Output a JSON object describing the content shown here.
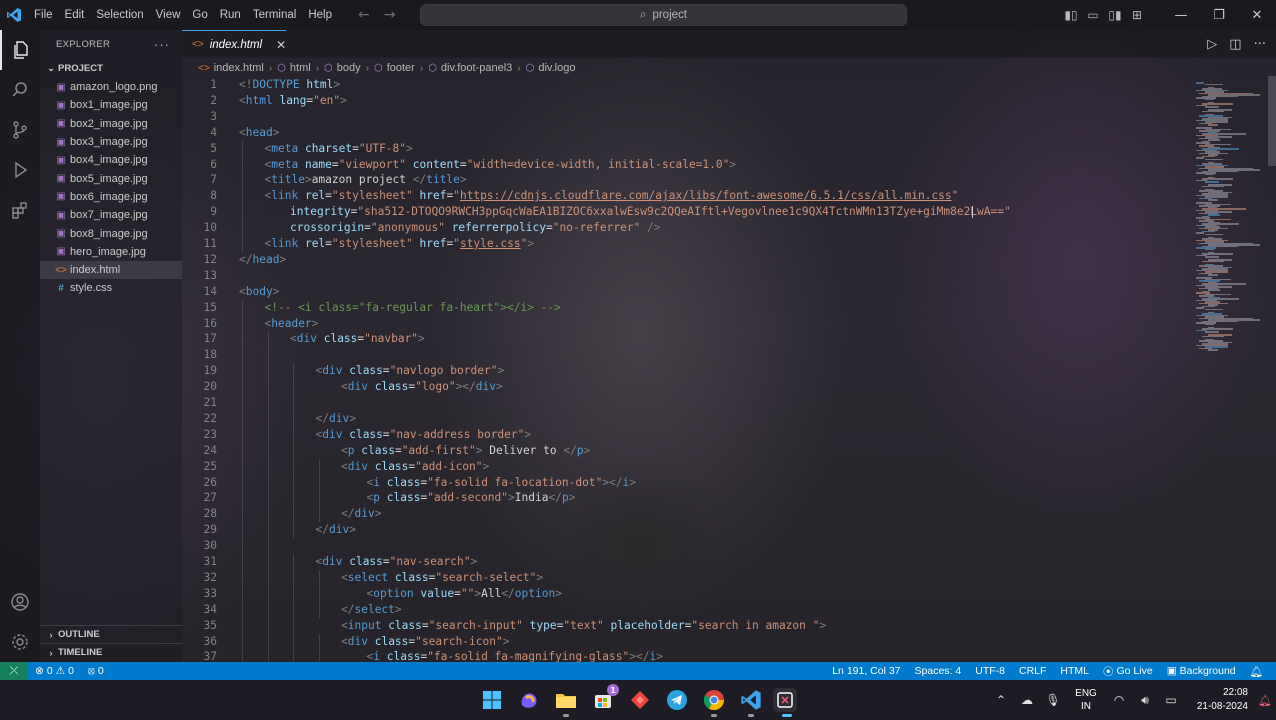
{
  "menu": [
    "File",
    "Edit",
    "Selection",
    "View",
    "Go",
    "Run",
    "Terminal",
    "Help"
  ],
  "search": {
    "label": "project"
  },
  "sidebar": {
    "title": "EXPLORER",
    "project": "PROJECT",
    "files": [
      {
        "name": "amazon_logo.png",
        "type": "image"
      },
      {
        "name": "box1_image.jpg",
        "type": "image"
      },
      {
        "name": "box2_image.jpg",
        "type": "image"
      },
      {
        "name": "box3_image.jpg",
        "type": "image"
      },
      {
        "name": "box4_image.jpg",
        "type": "image"
      },
      {
        "name": "box5_image.jpg",
        "type": "image"
      },
      {
        "name": "box6_image.jpg",
        "type": "image"
      },
      {
        "name": "box7_image.jpg",
        "type": "image"
      },
      {
        "name": "box8_image.jpg",
        "type": "image"
      },
      {
        "name": "hero_image.jpg",
        "type": "image"
      },
      {
        "name": "index.html",
        "type": "html",
        "selected": true
      },
      {
        "name": "style.css",
        "type": "css"
      }
    ],
    "outline": "OUTLINE",
    "timeline": "TIMELINE"
  },
  "tab": {
    "label": "index.html"
  },
  "breadcrumb": [
    "index.html",
    "html",
    "body",
    "footer",
    "div.foot-panel3",
    "div.logo"
  ],
  "code": [
    {
      "n": "1",
      "indent": 0,
      "html": "<span class=\"t\">&lt;!</span><span class=\"tag\">DOCTYPE</span> <span class=\"at\">html</span><span class=\"t\">&gt;</span>"
    },
    {
      "n": "2",
      "indent": 0,
      "html": "<span class=\"t\">&lt;</span><span class=\"tag\">html</span> <span class=\"at\">lang</span><span class=\"txt\">=</span><span class=\"str\">\"en\"</span><span class=\"t\">&gt;</span>"
    },
    {
      "n": "3",
      "indent": 0,
      "html": ""
    },
    {
      "n": "4",
      "indent": 0,
      "html": "<span class=\"t\">&lt;</span><span class=\"tag\">head</span><span class=\"t\">&gt;</span>"
    },
    {
      "n": "5",
      "indent": 1,
      "html": "<span class=\"t\">&lt;</span><span class=\"tag\">meta</span> <span class=\"at\">charset</span><span class=\"txt\">=</span><span class=\"str\">\"UTF-8\"</span><span class=\"t\">&gt;</span>"
    },
    {
      "n": "6",
      "indent": 1,
      "html": "<span class=\"t\">&lt;</span><span class=\"tag\">meta</span> <span class=\"at\">name</span><span class=\"txt\">=</span><span class=\"str\">\"viewport\"</span> <span class=\"at\">content</span><span class=\"txt\">=</span><span class=\"str\">\"width=device-width, initial-scale=1.0\"</span><span class=\"t\">&gt;</span>"
    },
    {
      "n": "7",
      "indent": 1,
      "html": "<span class=\"t\">&lt;</span><span class=\"tag\">title</span><span class=\"t\">&gt;</span><span class=\"txt\">amazon project </span><span class=\"t\">&lt;/</span><span class=\"tag\">title</span><span class=\"t\">&gt;</span>"
    },
    {
      "n": "8",
      "indent": 1,
      "html": "<span class=\"t\">&lt;</span><span class=\"tag\">link</span> <span class=\"at\">rel</span><span class=\"txt\">=</span><span class=\"str\">\"stylesheet\"</span> <span class=\"at\">href</span><span class=\"txt\">=</span><span class=\"str\">\"<span class=\"lnk\">https://cdnjs.cloudflare.com/ajax/libs/font-awesome/6.5.1/css/all.min.css</span>\"</span>"
    },
    {
      "n": "9",
      "indent": 2,
      "html": "<span class=\"at\">integrity</span><span class=\"txt\">=</span><span class=\"str\">\"sha512-DTOQO9RWCH3ppGqcWaEA1BIZOC6xxalwEsw9c2QQeAIftl+Vegovlnee1c9QX4TctnWMn13TZye+giMm8e2LwA==\"</span>"
    },
    {
      "n": "10",
      "indent": 2,
      "html": "<span class=\"at\">crossorigin</span><span class=\"txt\">=</span><span class=\"str\">\"anonymous\"</span> <span class=\"at\">referrerpolicy</span><span class=\"txt\">=</span><span class=\"str\">\"no-referrer\"</span> <span class=\"t\">/&gt;</span>"
    },
    {
      "n": "11",
      "indent": 1,
      "html": "<span class=\"t\">&lt;</span><span class=\"tag\">link</span> <span class=\"at\">rel</span><span class=\"txt\">=</span><span class=\"str\">\"stylesheet\"</span> <span class=\"at\">href</span><span class=\"txt\">=</span><span class=\"str\">\"<span class=\"lnk\">style.css</span>\"</span><span class=\"t\">&gt;</span>"
    },
    {
      "n": "12",
      "indent": 0,
      "html": "<span class=\"t\">&lt;/</span><span class=\"tag\">head</span><span class=\"t\">&gt;</span>"
    },
    {
      "n": "13",
      "indent": 0,
      "html": ""
    },
    {
      "n": "14",
      "indent": 0,
      "html": "<span class=\"t\">&lt;</span><span class=\"tag\">body</span><span class=\"t\">&gt;</span>"
    },
    {
      "n": "15",
      "indent": 1,
      "html": "<span class=\"cm\">&lt;!-- &lt;i class=\"fa-regular fa-heart\"&gt;&lt;/i&gt; --&gt;</span>"
    },
    {
      "n": "16",
      "indent": 1,
      "html": "<span class=\"t\">&lt;</span><span class=\"tag\">header</span><span class=\"t\">&gt;</span>"
    },
    {
      "n": "17",
      "indent": 2,
      "html": "<span class=\"t\">&lt;</span><span class=\"tag\">div</span> <span class=\"at\">class</span><span class=\"txt\">=</span><span class=\"str\">\"navbar\"</span><span class=\"t\">&gt;</span>"
    },
    {
      "n": "18",
      "indent": 0,
      "html": ""
    },
    {
      "n": "19",
      "indent": 3,
      "html": "<span class=\"t\">&lt;</span><span class=\"tag\">div</span> <span class=\"at\">class</span><span class=\"txt\">=</span><span class=\"str\">\"navlogo border\"</span><span class=\"t\">&gt;</span>"
    },
    {
      "n": "20",
      "indent": 4,
      "html": "<span class=\"t\">&lt;</span><span class=\"tag\">div</span> <span class=\"at\">class</span><span class=\"txt\">=</span><span class=\"str\">\"logo\"</span><span class=\"t\">&gt;&lt;/</span><span class=\"tag\">div</span><span class=\"t\">&gt;</span>"
    },
    {
      "n": "21",
      "indent": 0,
      "html": ""
    },
    {
      "n": "22",
      "indent": 3,
      "html": "<span class=\"t\">&lt;/</span><span class=\"tag\">div</span><span class=\"t\">&gt;</span>"
    },
    {
      "n": "23",
      "indent": 3,
      "html": "<span class=\"t\">&lt;</span><span class=\"tag\">div</span> <span class=\"at\">class</span><span class=\"txt\">=</span><span class=\"str\">\"nav-address border\"</span><span class=\"t\">&gt;</span>"
    },
    {
      "n": "24",
      "indent": 4,
      "html": "<span class=\"t\">&lt;</span><span class=\"tag\">p</span> <span class=\"at\">class</span><span class=\"txt\">=</span><span class=\"str\">\"add-first\"</span><span class=\"t\">&gt;</span><span class=\"txt\"> Deliver to </span><span class=\"t\">&lt;/</span><span class=\"tag\">p</span><span class=\"t\">&gt;</span>"
    },
    {
      "n": "25",
      "indent": 4,
      "html": "<span class=\"t\">&lt;</span><span class=\"tag\">div</span> <span class=\"at\">class</span><span class=\"txt\">=</span><span class=\"str\">\"add-icon\"</span><span class=\"t\">&gt;</span>"
    },
    {
      "n": "26",
      "indent": 5,
      "html": "<span class=\"t\">&lt;</span><span class=\"tag\">i</span> <span class=\"at\">class</span><span class=\"txt\">=</span><span class=\"str\">\"fa-solid fa-location-dot\"</span><span class=\"t\">&gt;&lt;/</span><span class=\"tag\">i</span><span class=\"t\">&gt;</span>"
    },
    {
      "n": "27",
      "indent": 5,
      "html": "<span class=\"t\">&lt;</span><span class=\"tag\">p</span> <span class=\"at\">class</span><span class=\"txt\">=</span><span class=\"str\">\"add-second\"</span><span class=\"t\">&gt;</span><span class=\"txt\">India</span><span class=\"t\">&lt;/</span><span class=\"tag\">p</span><span class=\"t\">&gt;</span>"
    },
    {
      "n": "28",
      "indent": 4,
      "html": "<span class=\"t\">&lt;/</span><span class=\"tag\">div</span><span class=\"t\">&gt;</span>"
    },
    {
      "n": "29",
      "indent": 3,
      "html": "<span class=\"t\">&lt;/</span><span class=\"tag\">div</span><span class=\"t\">&gt;</span>"
    },
    {
      "n": "30",
      "indent": 0,
      "html": ""
    },
    {
      "n": "31",
      "indent": 3,
      "html": "<span class=\"t\">&lt;</span><span class=\"tag\">div</span> <span class=\"at\">class</span><span class=\"txt\">=</span><span class=\"str\">\"nav-search\"</span><span class=\"t\">&gt;</span>"
    },
    {
      "n": "32",
      "indent": 4,
      "html": "<span class=\"t\">&lt;</span><span class=\"tag\">select</span> <span class=\"at\">class</span><span class=\"txt\">=</span><span class=\"str\">\"search-select\"</span><span class=\"t\">&gt;</span>"
    },
    {
      "n": "33",
      "indent": 5,
      "html": "<span class=\"t\">&lt;</span><span class=\"tag\">option</span> <span class=\"at\">value</span><span class=\"txt\">=</span><span class=\"str\">\"\"</span><span class=\"t\">&gt;</span><span class=\"txt\">All</span><span class=\"t\">&lt;/</span><span class=\"tag\">option</span><span class=\"t\">&gt;</span>"
    },
    {
      "n": "34",
      "indent": 4,
      "html": "<span class=\"t\">&lt;/</span><span class=\"tag\">select</span><span class=\"t\">&gt;</span>"
    },
    {
      "n": "35",
      "indent": 4,
      "html": "<span class=\"t\">&lt;</span><span class=\"tag\">input</span> <span class=\"at\">class</span><span class=\"txt\">=</span><span class=\"str\">\"search-input\"</span> <span class=\"at\">type</span><span class=\"txt\">=</span><span class=\"str\">\"text\"</span> <span class=\"at\">placeholder</span><span class=\"txt\">=</span><span class=\"str\">\"search in amazon \"</span><span class=\"t\">&gt;</span>"
    },
    {
      "n": "36",
      "indent": 4,
      "html": "<span class=\"t\">&lt;</span><span class=\"tag\">div</span> <span class=\"at\">class</span><span class=\"txt\">=</span><span class=\"str\">\"search-icon\"</span><span class=\"t\">&gt;</span>"
    },
    {
      "n": "37",
      "indent": 5,
      "html": "<span class=\"t\">&lt;</span><span class=\"tag\">i</span> <span class=\"at\">class</span><span class=\"txt\">=</span><span class=\"str\">\"fa-solid fa-magnifying-glass\"</span><span class=\"t\">&gt;&lt;/</span><span class=\"tag\">i</span><span class=\"t\">&gt;</span>"
    }
  ],
  "statusbar": {
    "errors": "0",
    "warnings": "0",
    "ports": "0",
    "position": "Ln 191, Col 37",
    "spaces": "Spaces: 4",
    "encoding": "UTF-8",
    "eol": "CRLF",
    "language": "HTML",
    "golive": "Go Live",
    "background": "Background"
  },
  "taskbar": {
    "lang_top": "ENG",
    "lang_bottom": "IN",
    "time": "22:08",
    "date": "21-08-2024",
    "store_badge": "1"
  },
  "colors": {
    "statusbar": "#007acc",
    "remote": "#16825d",
    "accent": "#3ea4f2"
  }
}
